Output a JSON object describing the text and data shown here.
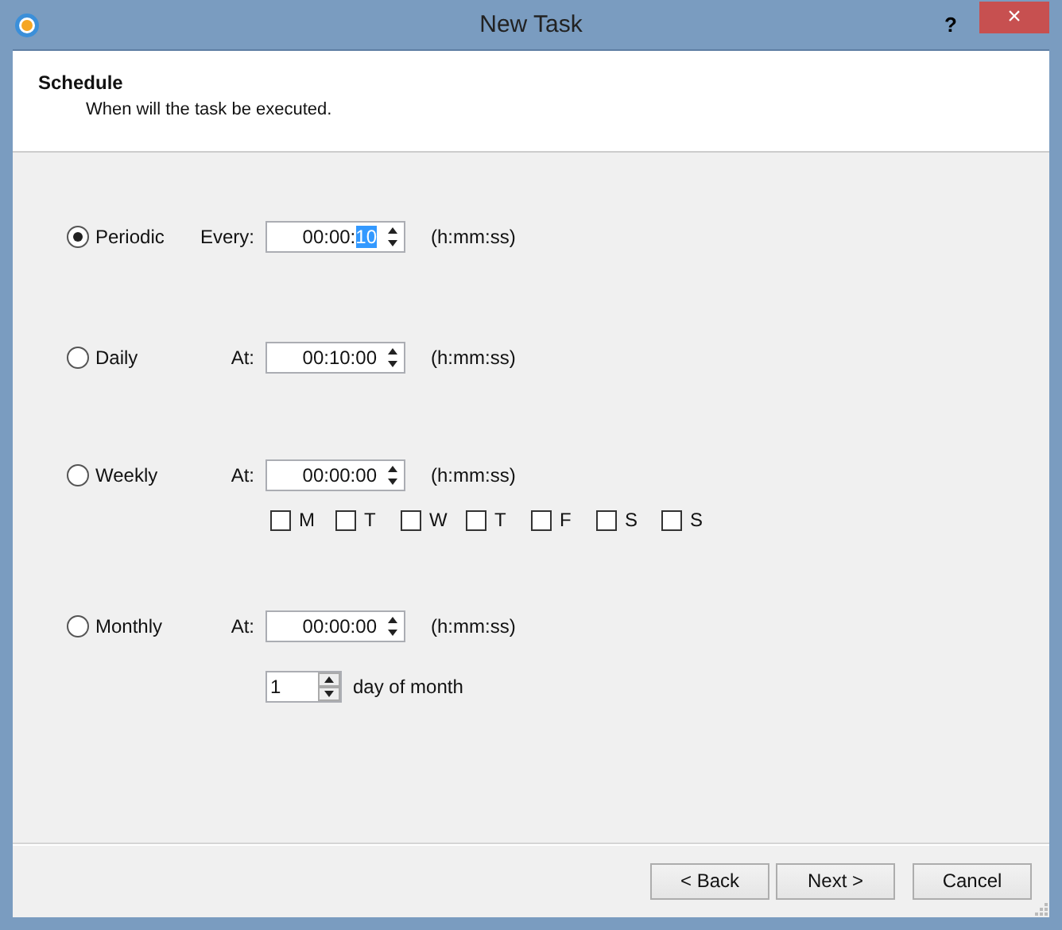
{
  "window": {
    "title": "New Task",
    "help": "?",
    "close": "×"
  },
  "header": {
    "title": "Schedule",
    "subtitle": "When will the task be executed."
  },
  "schedules": [
    {
      "label": "Periodic",
      "selected": true,
      "at_label": "Every:",
      "value": "00:00:",
      "highlighted": "10",
      "hint": "(h:mm:ss)"
    },
    {
      "label": "Daily",
      "selected": false,
      "at_label": "At:",
      "value": "00:10:00",
      "hint": "(h:mm:ss)"
    },
    {
      "label": "Weekly",
      "selected": false,
      "at_label": "At:",
      "value": "00:00:00",
      "hint": "(h:mm:ss)",
      "days": [
        {
          "label": "M",
          "checked": false
        },
        {
          "label": "T",
          "checked": false
        },
        {
          "label": "W",
          "checked": false
        },
        {
          "label": "T",
          "checked": false
        },
        {
          "label": "F",
          "checked": false
        },
        {
          "label": "S",
          "checked": false
        },
        {
          "label": "S",
          "checked": false
        }
      ]
    },
    {
      "label": "Monthly",
      "selected": false,
      "at_label": "At:",
      "value": "00:00:00",
      "hint": "(h:mm:ss)",
      "day_of_month": {
        "value": "1",
        "label": "day of month"
      }
    }
  ],
  "buttons": [
    {
      "label": "< Back"
    },
    {
      "label": "Next >"
    },
    {
      "label": "Cancel"
    }
  ]
}
